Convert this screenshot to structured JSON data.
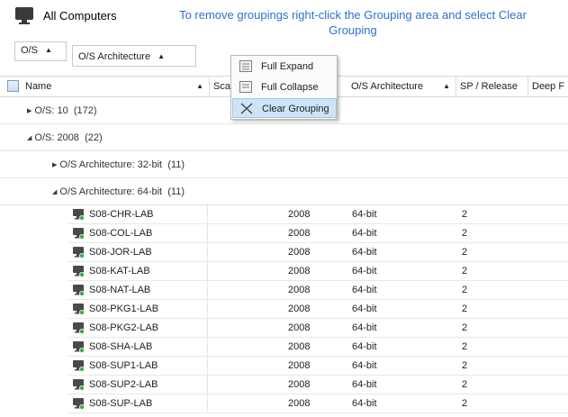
{
  "header": {
    "title": "All Computers",
    "hint": "To remove groupings right-click the Grouping area and select Clear Grouping"
  },
  "grouping": [
    {
      "label": "O/S"
    },
    {
      "label": "O/S Architecture"
    }
  ],
  "context_menu": {
    "items": [
      {
        "label": "Full Expand",
        "icon": "list-icon"
      },
      {
        "label": "Full Collapse",
        "icon": "list-icon"
      },
      {
        "label": "Clear Grouping",
        "icon": "x-icon",
        "highlighted": true
      }
    ]
  },
  "columns": [
    "Name",
    "Scan",
    "O/S Architecture",
    "SP / Release",
    "Deep F"
  ],
  "groups": [
    {
      "label": "O/S: 10",
      "count": "(172)",
      "expanded": false
    },
    {
      "label": "O/S: 2008",
      "count": "(22)",
      "expanded": true
    },
    {
      "label": "O/S Architecture: 32-bit",
      "count": "(11)",
      "expanded": false
    },
    {
      "label": "O/S Architecture: 64-bit",
      "count": "(11)",
      "expanded": true
    }
  ],
  "rows": [
    {
      "name": "S08-CHR-LAB",
      "os": "2008",
      "arch": "64-bit",
      "sp": "2"
    },
    {
      "name": "S08-COL-LAB",
      "os": "2008",
      "arch": "64-bit",
      "sp": "2"
    },
    {
      "name": "S08-JOR-LAB",
      "os": "2008",
      "arch": "64-bit",
      "sp": "2"
    },
    {
      "name": "S08-KAT-LAB",
      "os": "2008",
      "arch": "64-bit",
      "sp": "2"
    },
    {
      "name": "S08-NAT-LAB",
      "os": "2008",
      "arch": "64-bit",
      "sp": "2"
    },
    {
      "name": "S08-PKG1-LAB",
      "os": "2008",
      "arch": "64-bit",
      "sp": "2"
    },
    {
      "name": "S08-PKG2-LAB",
      "os": "2008",
      "arch": "64-bit",
      "sp": "2"
    },
    {
      "name": "S08-SHA-LAB",
      "os": "2008",
      "arch": "64-bit",
      "sp": "2"
    },
    {
      "name": "S08-SUP1-LAB",
      "os": "2008",
      "arch": "64-bit",
      "sp": "2"
    },
    {
      "name": "S08-SUP2-LAB",
      "os": "2008",
      "arch": "64-bit",
      "sp": "2"
    },
    {
      "name": "S08-SUP-LAB",
      "os": "2008",
      "arch": "64-bit",
      "sp": "2"
    }
  ],
  "colors": {
    "hint": "#2f6fd0",
    "menu_highlight": "#cde4f7",
    "status_online": "#2fb34a"
  }
}
